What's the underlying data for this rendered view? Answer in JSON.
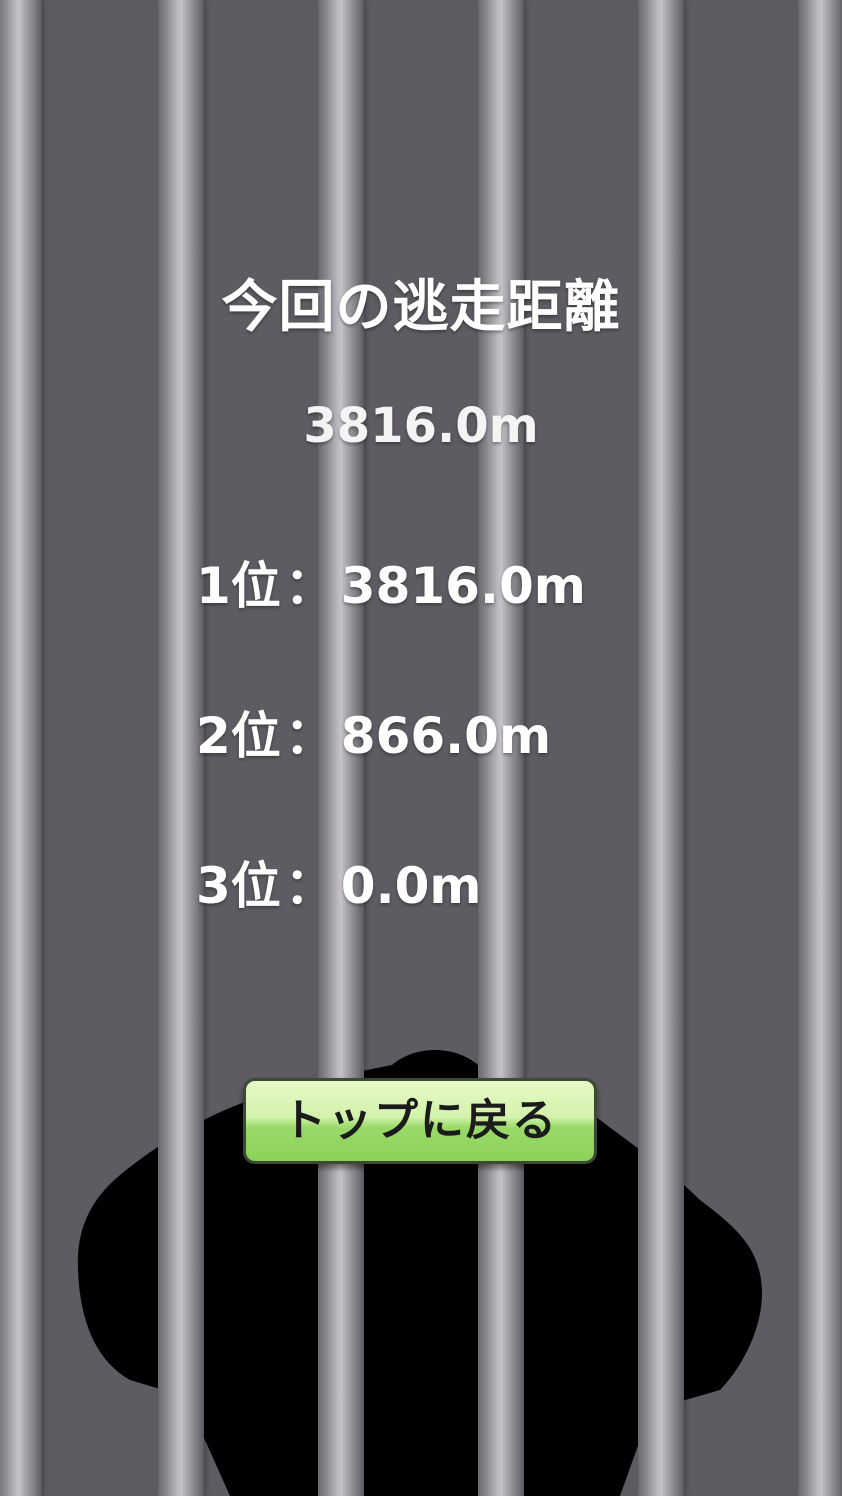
{
  "result": {
    "title": "今回の逃走距離",
    "distance": "3816.0m"
  },
  "ranking": [
    {
      "rank_label": "1位",
      "separator": "：",
      "value": "3816.0m"
    },
    {
      "rank_label": "2位",
      "separator": "：",
      "value": "866.0m"
    },
    {
      "rank_label": "3位",
      "separator": "：",
      "value": "0.0m"
    }
  ],
  "buttons": {
    "back_to_top_label": "トップに戻る"
  },
  "colors": {
    "background": "#5e5c62",
    "bar_highlight": "#c6c4c9",
    "silhouette": "#000000",
    "button_top": "#e6f9c7",
    "button_bottom": "#8bd25a",
    "text": "#ffffff"
  },
  "icons": {
    "background": "prison-bars",
    "figure": "prisoner-silhouette"
  }
}
